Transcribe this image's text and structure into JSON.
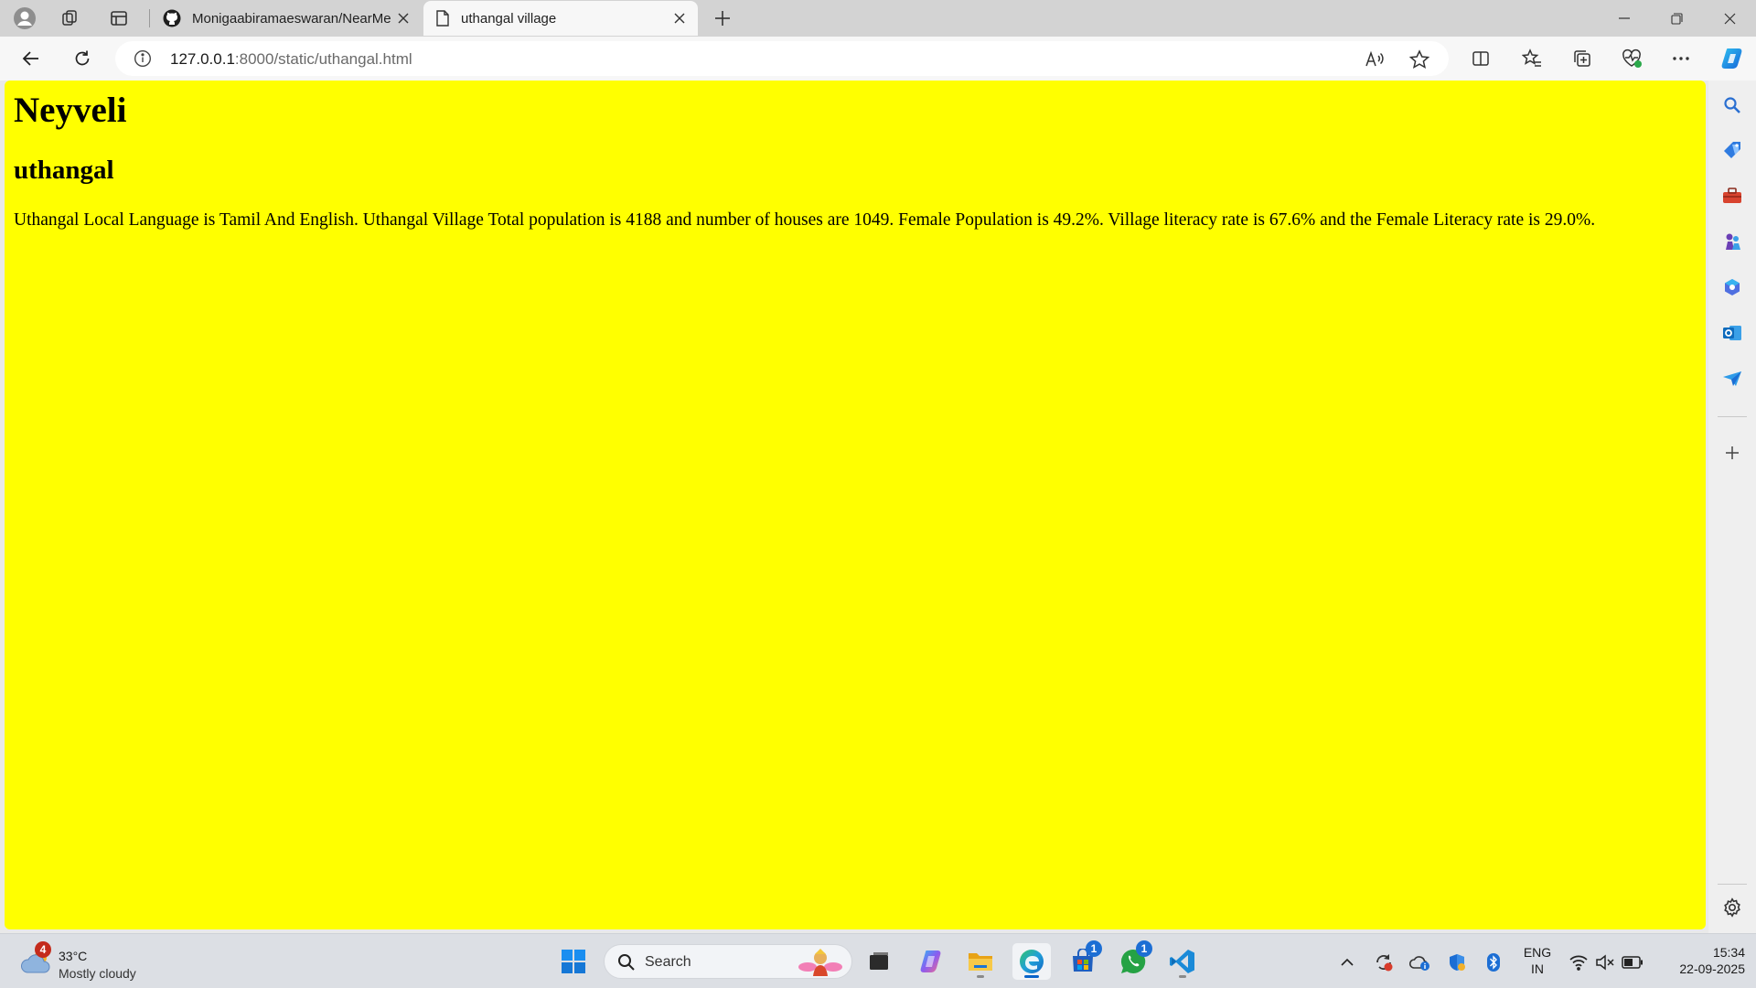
{
  "browser": {
    "tabs": [
      {
        "title": "Monigaabiramaeswaran/NearMe",
        "icon": "github-icon"
      },
      {
        "title": "uthangal village",
        "icon": "page-icon",
        "active": true
      }
    ],
    "address": {
      "host": "127.0.0.1",
      "path": ":8000/static/uthangal.html"
    }
  },
  "page": {
    "heading1": "Neyveli",
    "heading2": "uthangal",
    "paragraph": "Uthangal Local Language is Tamil And English. Uthangal Village Total population is 4188 and number of houses are 1049. Female Population is 49.2%. Village literacy rate is 67.6% and the Female Literacy rate is 29.0%.",
    "background": "#ffff00"
  },
  "taskbar": {
    "weather": {
      "temp": "33°C",
      "condition": "Mostly cloudy",
      "badge": "4"
    },
    "search_label": "Search",
    "store_badge": "1",
    "whatsapp_badge": "1",
    "lang": {
      "line1": "ENG",
      "line2": "IN"
    },
    "clock": {
      "time": "15:34",
      "date": "22-09-2025"
    }
  },
  "colors": {
    "accent": "#0a63c9",
    "page_bg": "#ffff00"
  }
}
